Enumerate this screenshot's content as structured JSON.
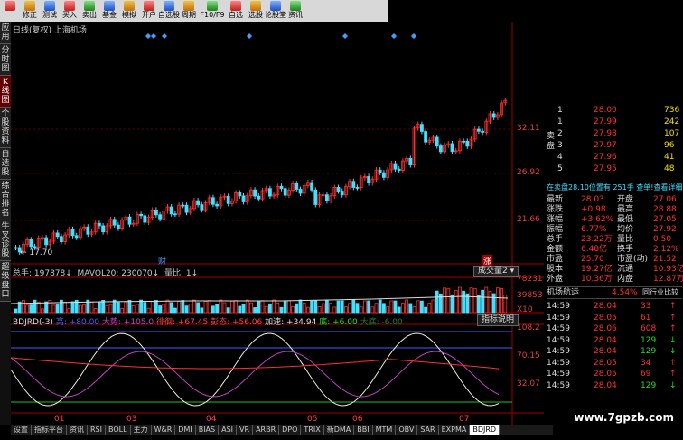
{
  "toolbar": {
    "buttons": [
      "修正",
      "测试",
      "买入",
      "卖出",
      "基金",
      "模拟",
      "开户",
      "自选股",
      "周期",
      "F10/F9",
      "自选",
      "选股",
      "论股堂",
      "资讯"
    ]
  },
  "left_tabs": [
    "应用",
    "分时图",
    "K线图",
    "个股资料",
    "自选股",
    "综合排名",
    "牛叉诊股",
    "超级盘口"
  ],
  "chart": {
    "title": "日线(复权)  上海机场",
    "price_labels": [
      "32.11",
      "26.92",
      "21.66"
    ],
    "low_label": "17.70",
    "vol_labels": [
      "78231",
      "39853",
      "X10"
    ],
    "ind_labels": [
      "108.2",
      "70.15",
      "32.07"
    ],
    "month_labels": [
      "01",
      "03",
      "04",
      "05",
      "06",
      "07"
    ],
    "marker_cai": "财",
    "marker_zhang": "涨"
  },
  "volume_info": {
    "total": "总手: 197878",
    "mavol": "MAVOL20: 230070",
    "ratio": "量比: 1",
    "button": "成交量2"
  },
  "indicator_info": {
    "name": "BDJRD(-3)",
    "values": [
      "高: +80.00",
      "大势: +105.0",
      "徘徊: +67.45",
      "彭态: +56.06",
      "加速: +34.94",
      "底: +6.00",
      "大底: -6.00"
    ],
    "button": "指标说明"
  },
  "bottom_tabs": [
    "设置",
    "指标平台",
    "资讯",
    "RSI",
    "BOLL",
    "主力",
    "W&R",
    "DMI",
    "BIAS",
    "ASI",
    "VR",
    "ARBR",
    "DPO",
    "TRIX",
    "新DMA",
    "BBI",
    "MTM",
    "OBV",
    "SAR",
    "EXPMA",
    "BDJRD"
  ],
  "orderbook": {
    "sell_label": "卖盘",
    "buy_label": "买盘",
    "rows": [
      {
        "lv": "1",
        "price": "28.00",
        "vol": "736"
      },
      {
        "lv": "1",
        "price": "27.99",
        "vol": "242"
      },
      {
        "lv": "2",
        "price": "27.98",
        "vol": "107"
      },
      {
        "lv": "3",
        "price": "27.97",
        "vol": "96"
      },
      {
        "lv": "4",
        "price": "27.96",
        "vol": "41"
      },
      {
        "lv": "5",
        "price": "27.95",
        "vol": "48"
      }
    ]
  },
  "quote": {
    "header": "在卖盘28.10位置有  251手  查单!查看详细",
    "lines": [
      [
        "最新",
        "28.03",
        "开盘",
        "27.06"
      ],
      [
        "涨跌",
        "+0.98",
        "最高",
        "28.88"
      ],
      [
        "涨幅",
        "+3.62%",
        "最低",
        "27.05"
      ],
      [
        "振幅",
        "6.77%",
        "均价",
        "27.92"
      ],
      [
        "总手",
        "23.22万",
        "量比",
        "0.50"
      ],
      [
        "金额",
        "6.48亿",
        "换手",
        "2.12%"
      ],
      [
        "市盈",
        "25.70",
        "市盈(动)",
        "21.52"
      ],
      [
        "股本",
        "19.27亿",
        "流通",
        "10.93亿"
      ],
      [
        "外盘",
        "10.36万",
        "内盘",
        "12.87万"
      ]
    ],
    "industry": "机场航运",
    "industry_pct": "4.54%",
    "industry_rank": "同行业比较"
  },
  "ticks": [
    {
      "t": "14:59",
      "p": "28.04",
      "v": "33"
    },
    {
      "t": "14:59",
      "p": "28.05",
      "v": "61"
    },
    {
      "t": "14:59",
      "p": "28.06",
      "v": "608"
    },
    {
      "t": "14:59",
      "p": "28.04",
      "v": "129"
    },
    {
      "t": "14:59",
      "p": "28.04",
      "v": "129"
    },
    {
      "t": "14:59",
      "p": "28.05",
      "v": "34"
    },
    {
      "t": "14:59",
      "p": "28.05",
      "v": "69"
    },
    {
      "t": "14:59",
      "p": "28.04",
      "v": "129"
    }
  ],
  "watermark": "www.7gpzb.com"
}
